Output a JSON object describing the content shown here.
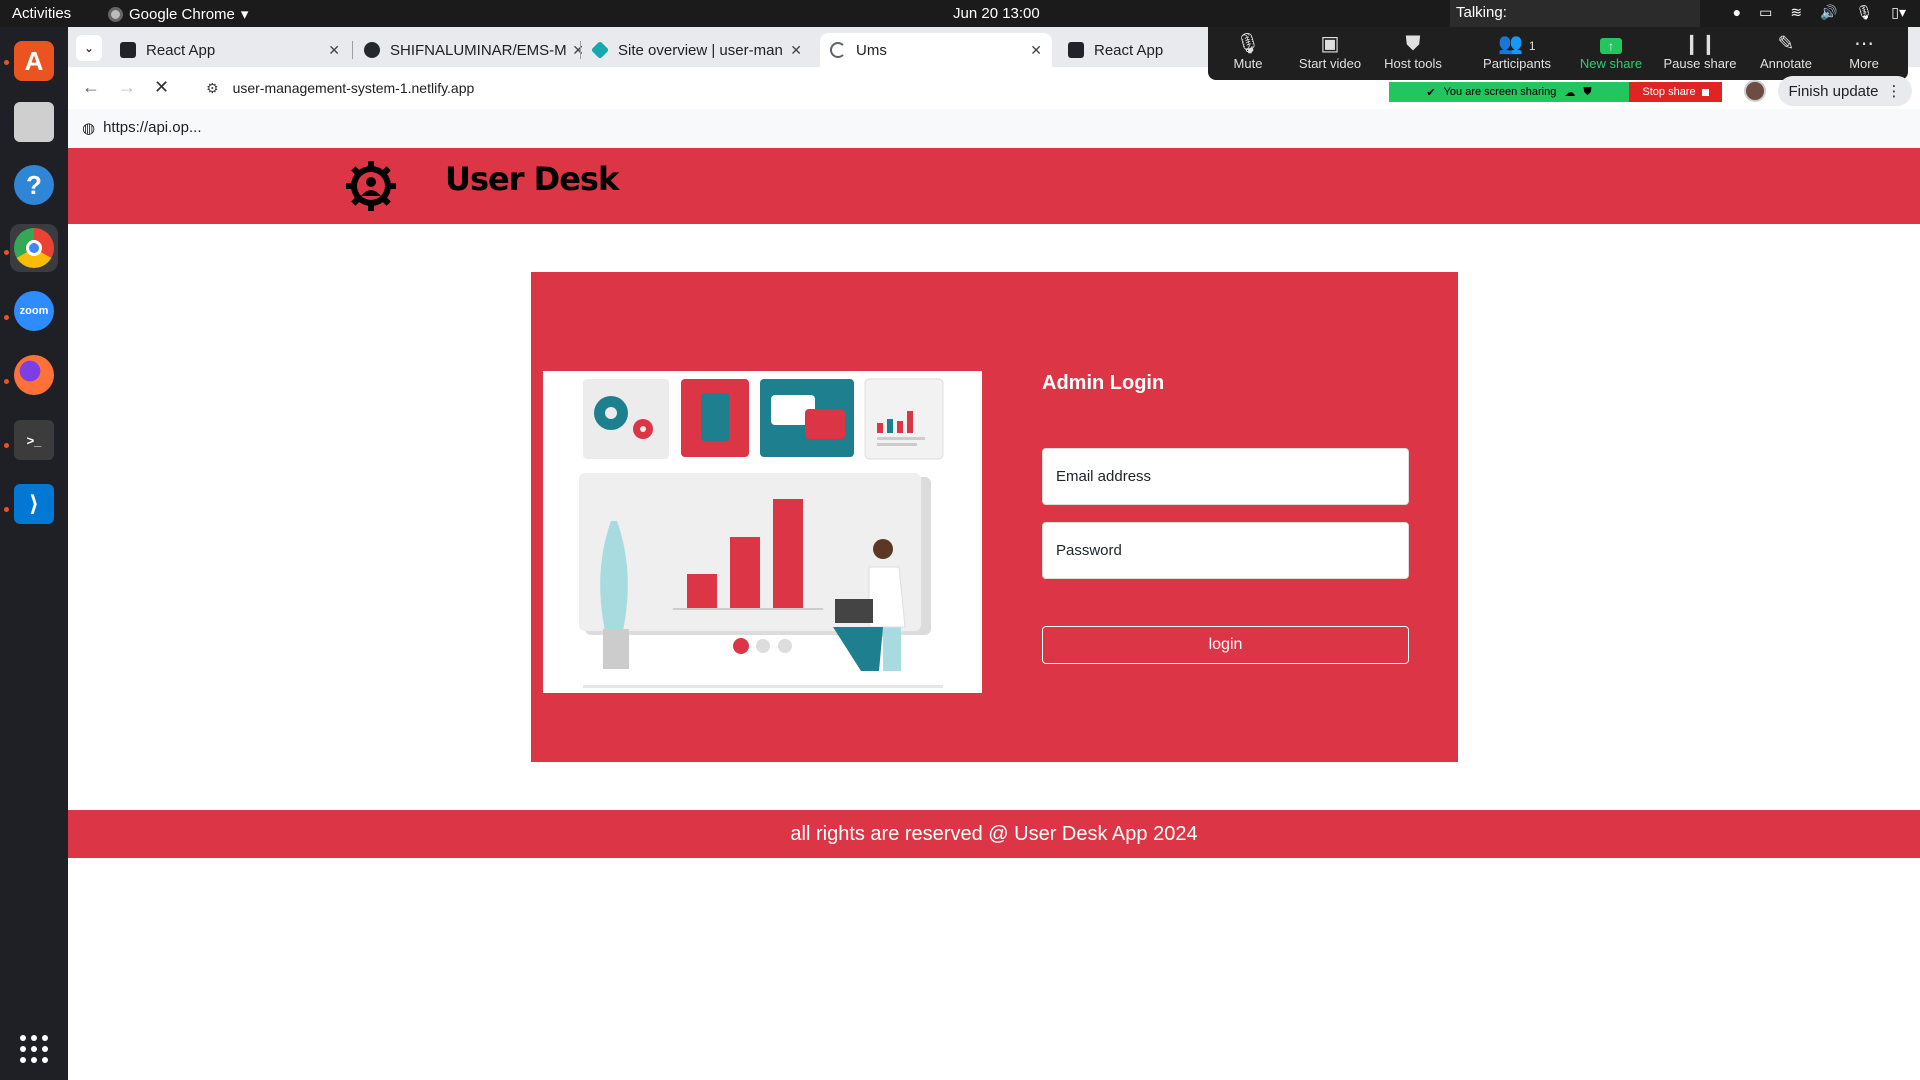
{
  "os": {
    "activities": "Activities",
    "app_name": "Google Chrome",
    "clock": "Jun 20  13:00",
    "talking_label": "Talking:"
  },
  "browser": {
    "tabs": [
      {
        "label": "React App",
        "icon": "react-icon"
      },
      {
        "label": "SHIFNALUMINAR/EMS-M",
        "icon": "github-icon"
      },
      {
        "label": "Site overview | user-man",
        "icon": "netlify-icon"
      },
      {
        "label": "Ums",
        "icon": "loading-icon"
      },
      {
        "label": "React App",
        "icon": "react-icon"
      }
    ],
    "url": "user-management-system-1.netlify.app",
    "status_url": "https://api.op..."
  },
  "zoom": {
    "items": [
      {
        "label": "Mute",
        "icon": "mic-icon"
      },
      {
        "label": "Start video",
        "icon": "video-off-icon"
      },
      {
        "label": "Host tools",
        "icon": "shield-icon"
      },
      {
        "label": "Participants",
        "icon": "participants-icon",
        "count": "1"
      },
      {
        "label": "New share",
        "icon": "share-icon"
      },
      {
        "label": "Pause share",
        "icon": "pause-icon"
      },
      {
        "label": "Annotate",
        "icon": "pencil-icon"
      },
      {
        "label": "More",
        "icon": "more-icon"
      }
    ],
    "sharing_text": "You are screen sharing",
    "stop_share": "Stop share",
    "finish_update": "Finish update"
  },
  "app": {
    "brand": "User Desk",
    "login_title": "Admin Login",
    "email_placeholder": "Email address",
    "password_placeholder": "Password",
    "login_button": "login",
    "footer": "all rights are reserved @ User Desk App 2024",
    "accent_color": "#dc3545"
  }
}
